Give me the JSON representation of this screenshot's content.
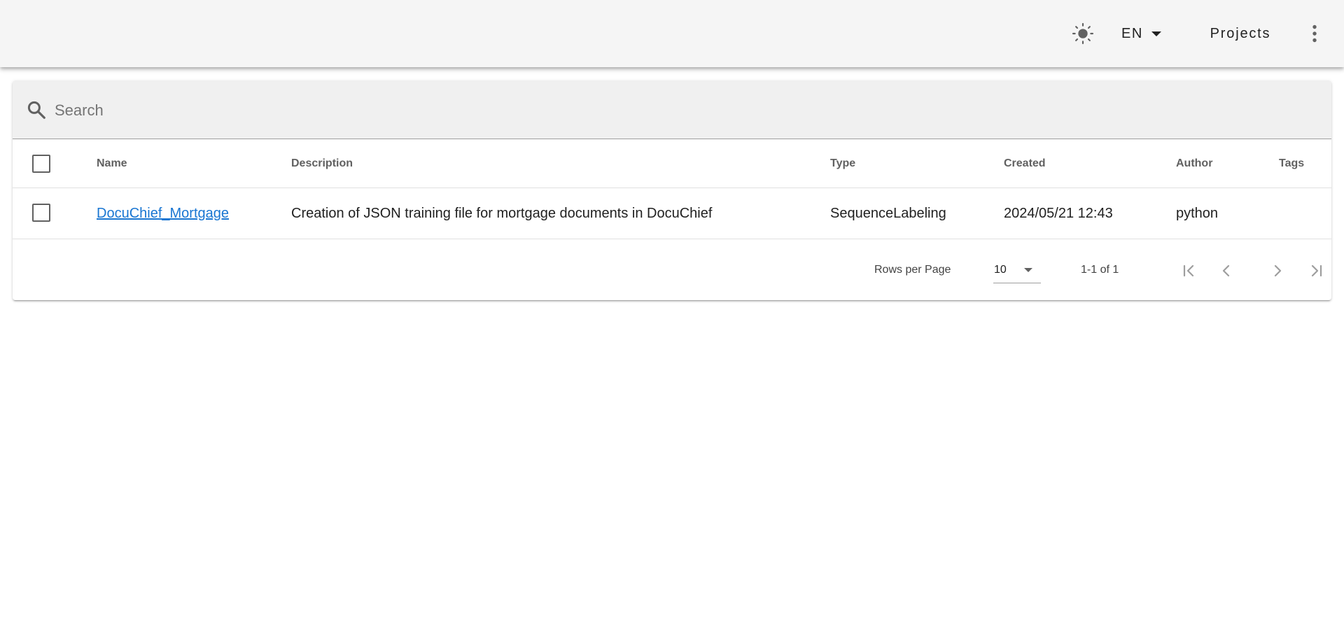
{
  "appbar": {
    "theme_icon": "sun-icon",
    "language": "EN",
    "projects_label": "Projects",
    "menu_icon": "dots-vertical-icon"
  },
  "search": {
    "placeholder": "Search",
    "value": ""
  },
  "table": {
    "columns": [
      "Name",
      "Description",
      "Type",
      "Created",
      "Author",
      "Tags"
    ],
    "rows": [
      {
        "name": "DocuChief_Mortgage",
        "description": "Creation of JSON training file for mortgage documents in DocuChief",
        "type": "SequenceLabeling",
        "created": "2024/05/21 12:43",
        "author": "python",
        "tags": ""
      }
    ]
  },
  "pagination": {
    "rows_per_page_label": "Rows per Page",
    "rows_per_page_value": "10",
    "range_text": "1-1 of 1"
  },
  "colors": {
    "appbar_bg": "#f5f5f5",
    "search_bg": "#f0f0f0",
    "link": "#1976d2"
  }
}
